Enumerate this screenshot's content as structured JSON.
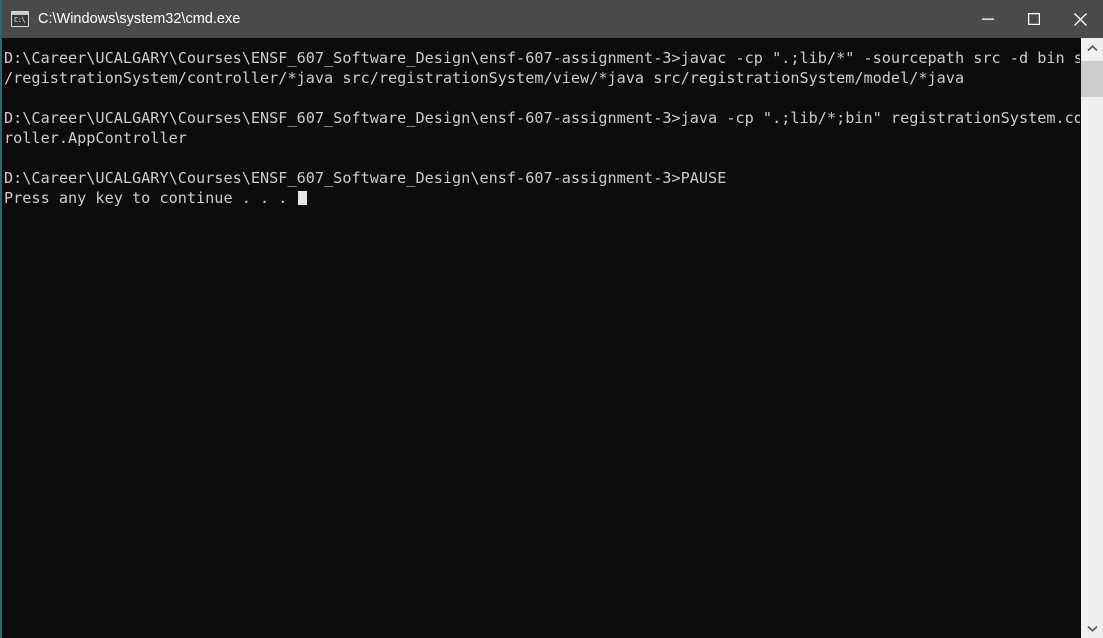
{
  "window": {
    "title": "C:\\Windows\\system32\\cmd.exe",
    "icon": "cmd-icon",
    "icon_text": "C:\\",
    "background_color": "#0c0c0c",
    "titlebar_color": "#4a4a4a",
    "text_color": "#cccccc",
    "border_accent_color": "#2a686f"
  },
  "titlebar_controls": {
    "minimize_label": "Minimize",
    "maximize_label": "Maximize",
    "close_label": "Close"
  },
  "console": {
    "lines": [
      "D:\\Career\\UCALGARY\\Courses\\ENSF_607_Software_Design\\ensf-607-assignment-3>javac -cp \".;lib/*\" -sourcepath src -d bin src",
      "/registrationSystem/controller/*java src/registrationSystem/view/*java src/registrationSystem/model/*java",
      "",
      "D:\\Career\\UCALGARY\\Courses\\ENSF_607_Software_Design\\ensf-607-assignment-3>java -cp \".;lib/*;bin\" registrationSystem.cont",
      "roller.AppController",
      "",
      "D:\\Career\\UCALGARY\\Courses\\ENSF_607_Software_Design\\ensf-607-assignment-3>PAUSE",
      "Press any key to continue . . . "
    ],
    "cursor_line_index": 7,
    "prompt_path": "D:\\Career\\UCALGARY\\Courses\\ENSF_607_Software_Design\\ensf-607-assignment-3",
    "commands": [
      "javac -cp \".;lib/*\" -sourcepath src -d bin src/registrationSystem/controller/*java src/registrationSystem/view/*java src/registrationSystem/model/*java",
      "java -cp \".;lib/*;bin\" registrationSystem.controller.AppController",
      "PAUSE"
    ],
    "output": "Press any key to continue . . ."
  },
  "scrollbar": {
    "up_arrow": "chevron-up-icon",
    "down_arrow": "chevron-down-icon",
    "thumb_color": "#cdcdcd",
    "track_color": "#f0f0f0"
  }
}
